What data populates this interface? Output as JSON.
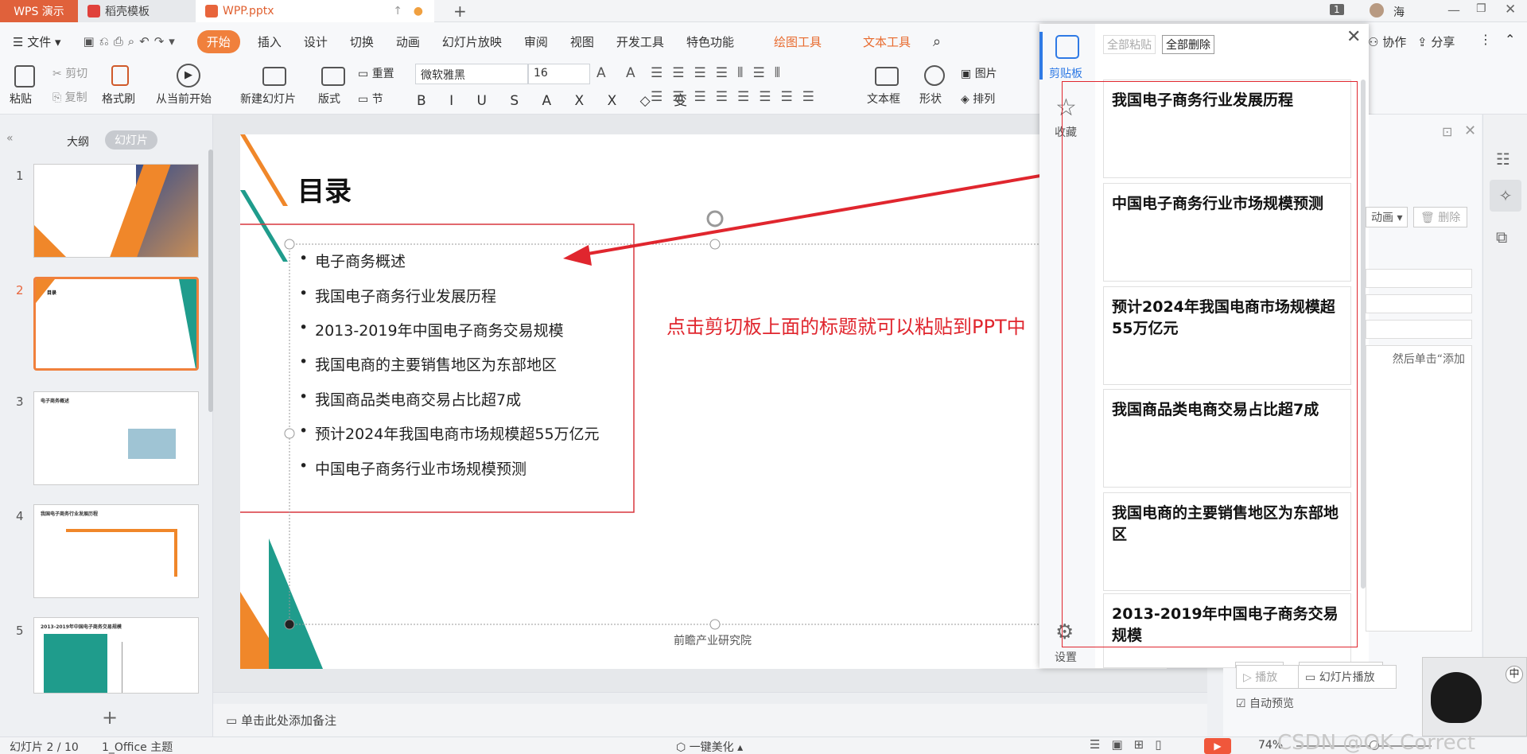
{
  "titlebar": {
    "tabs": [
      "WPS 演示",
      "稻壳模板",
      "WPP.pptx"
    ],
    "page_badge": "1",
    "user": "海"
  },
  "menubar": {
    "file": "文件",
    "items": [
      "开始",
      "插入",
      "设计",
      "切换",
      "动画",
      "幻灯片放映",
      "审阅",
      "视图",
      "开发工具",
      "特色功能",
      "绘图工具",
      "文本工具"
    ],
    "collab": "协作",
    "share": "分享"
  },
  "ribbon": {
    "paste": "粘贴",
    "cut": "剪切",
    "copy": "复制",
    "format_brush": "格式刷",
    "from_current": "从当前开始",
    "new_slide": "新建幻灯片",
    "layout": "版式",
    "reset": "重置",
    "section": "节",
    "font_name": "微软雅黑",
    "font_size": "16",
    "textbox": "文本框",
    "shape": "形状",
    "picture": "图片",
    "arrange": "排列"
  },
  "leftpanel": {
    "tab_outline": "大纲",
    "tab_slides": "幻灯片",
    "slide_numbers": [
      "1",
      "2",
      "3",
      "4",
      "5"
    ],
    "thumb3_title": "电子商务概述",
    "thumb4_title": "我国电子商务行业发展历程",
    "thumb5_title": "2013-2019年中国电子商务交易规模"
  },
  "slide": {
    "title": "目录",
    "bullets": [
      "电子商务概述",
      "我国电子商务行业发展历程",
      "2013-2019年中国电子商务交易规模",
      "我国电商的主要销售地区为东部地区",
      "我国商品类电商交易占比超7成",
      "预计2024年我国电商市场规模超55万亿元",
      "中国电子商务行业市场规模预测"
    ],
    "footer": "前瞻产业研究院",
    "annotation": "点击剪切板上面的标题就可以粘贴到PPT中",
    "accent_orange": "#f0872a",
    "accent_teal": "#1f9c8c"
  },
  "clipboard": {
    "sidebar": [
      "剪贴板",
      "收藏",
      "设置"
    ],
    "paste_all": "全部粘贴",
    "delete_all": "全部删除",
    "items": [
      "我国电子商务行业发展历程",
      "中国电子商务行业市场规模预测",
      "预计2024年我国电商市场规模超55万亿元",
      "我国商品类电商交易占比超7成",
      "我国电商的主要销售地区为东部地区",
      "2013-2019年中国电子商务交易规模"
    ]
  },
  "rightpanel": {
    "anim_label": "动画",
    "delete": "删除",
    "hint": "然后单击“添加",
    "play": "播放",
    "slideshow": "幻灯片播放",
    "autopreview": "自动预览"
  },
  "notes": {
    "placeholder": "单击此处添加备注"
  },
  "statusbar": {
    "slide_info": "幻灯片 2 / 10",
    "theme": "1_Office 主题",
    "beautify": "一键美化",
    "zoom": "74%",
    "watermark": "CSDN @OK Correct"
  },
  "ime": {
    "label": "中"
  }
}
